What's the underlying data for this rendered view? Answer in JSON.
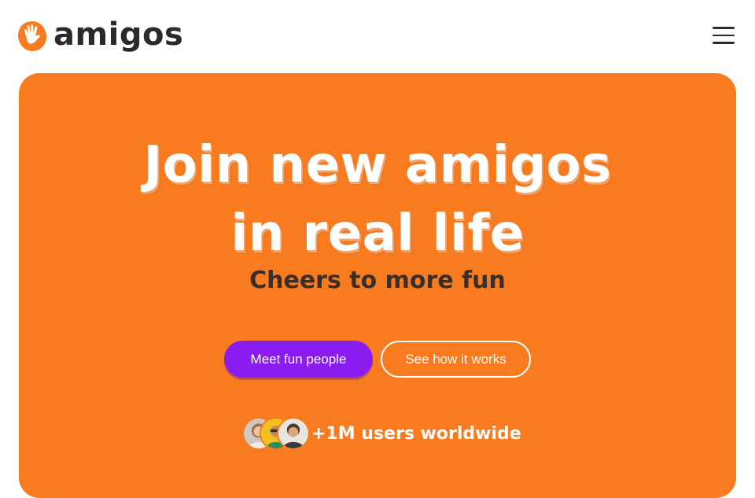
{
  "brand": {
    "name": "amigos",
    "logo_icon": "waving-hand-icon",
    "accent_color": "#f97b20",
    "text_color": "#2a2a2a"
  },
  "header": {
    "menu_icon": "hamburger-menu-icon"
  },
  "hero": {
    "background_color": "#f97b20",
    "title_line1": "Join new amigos",
    "title_line2": "in real life",
    "subtitle": "Cheers to more fun",
    "primary_button": {
      "label": "Meet fun people",
      "color": "#8a1cf0"
    },
    "secondary_button": {
      "label": "See how it works"
    },
    "social_proof": {
      "text": "+1M users worldwide",
      "avatar_count": 3
    }
  }
}
